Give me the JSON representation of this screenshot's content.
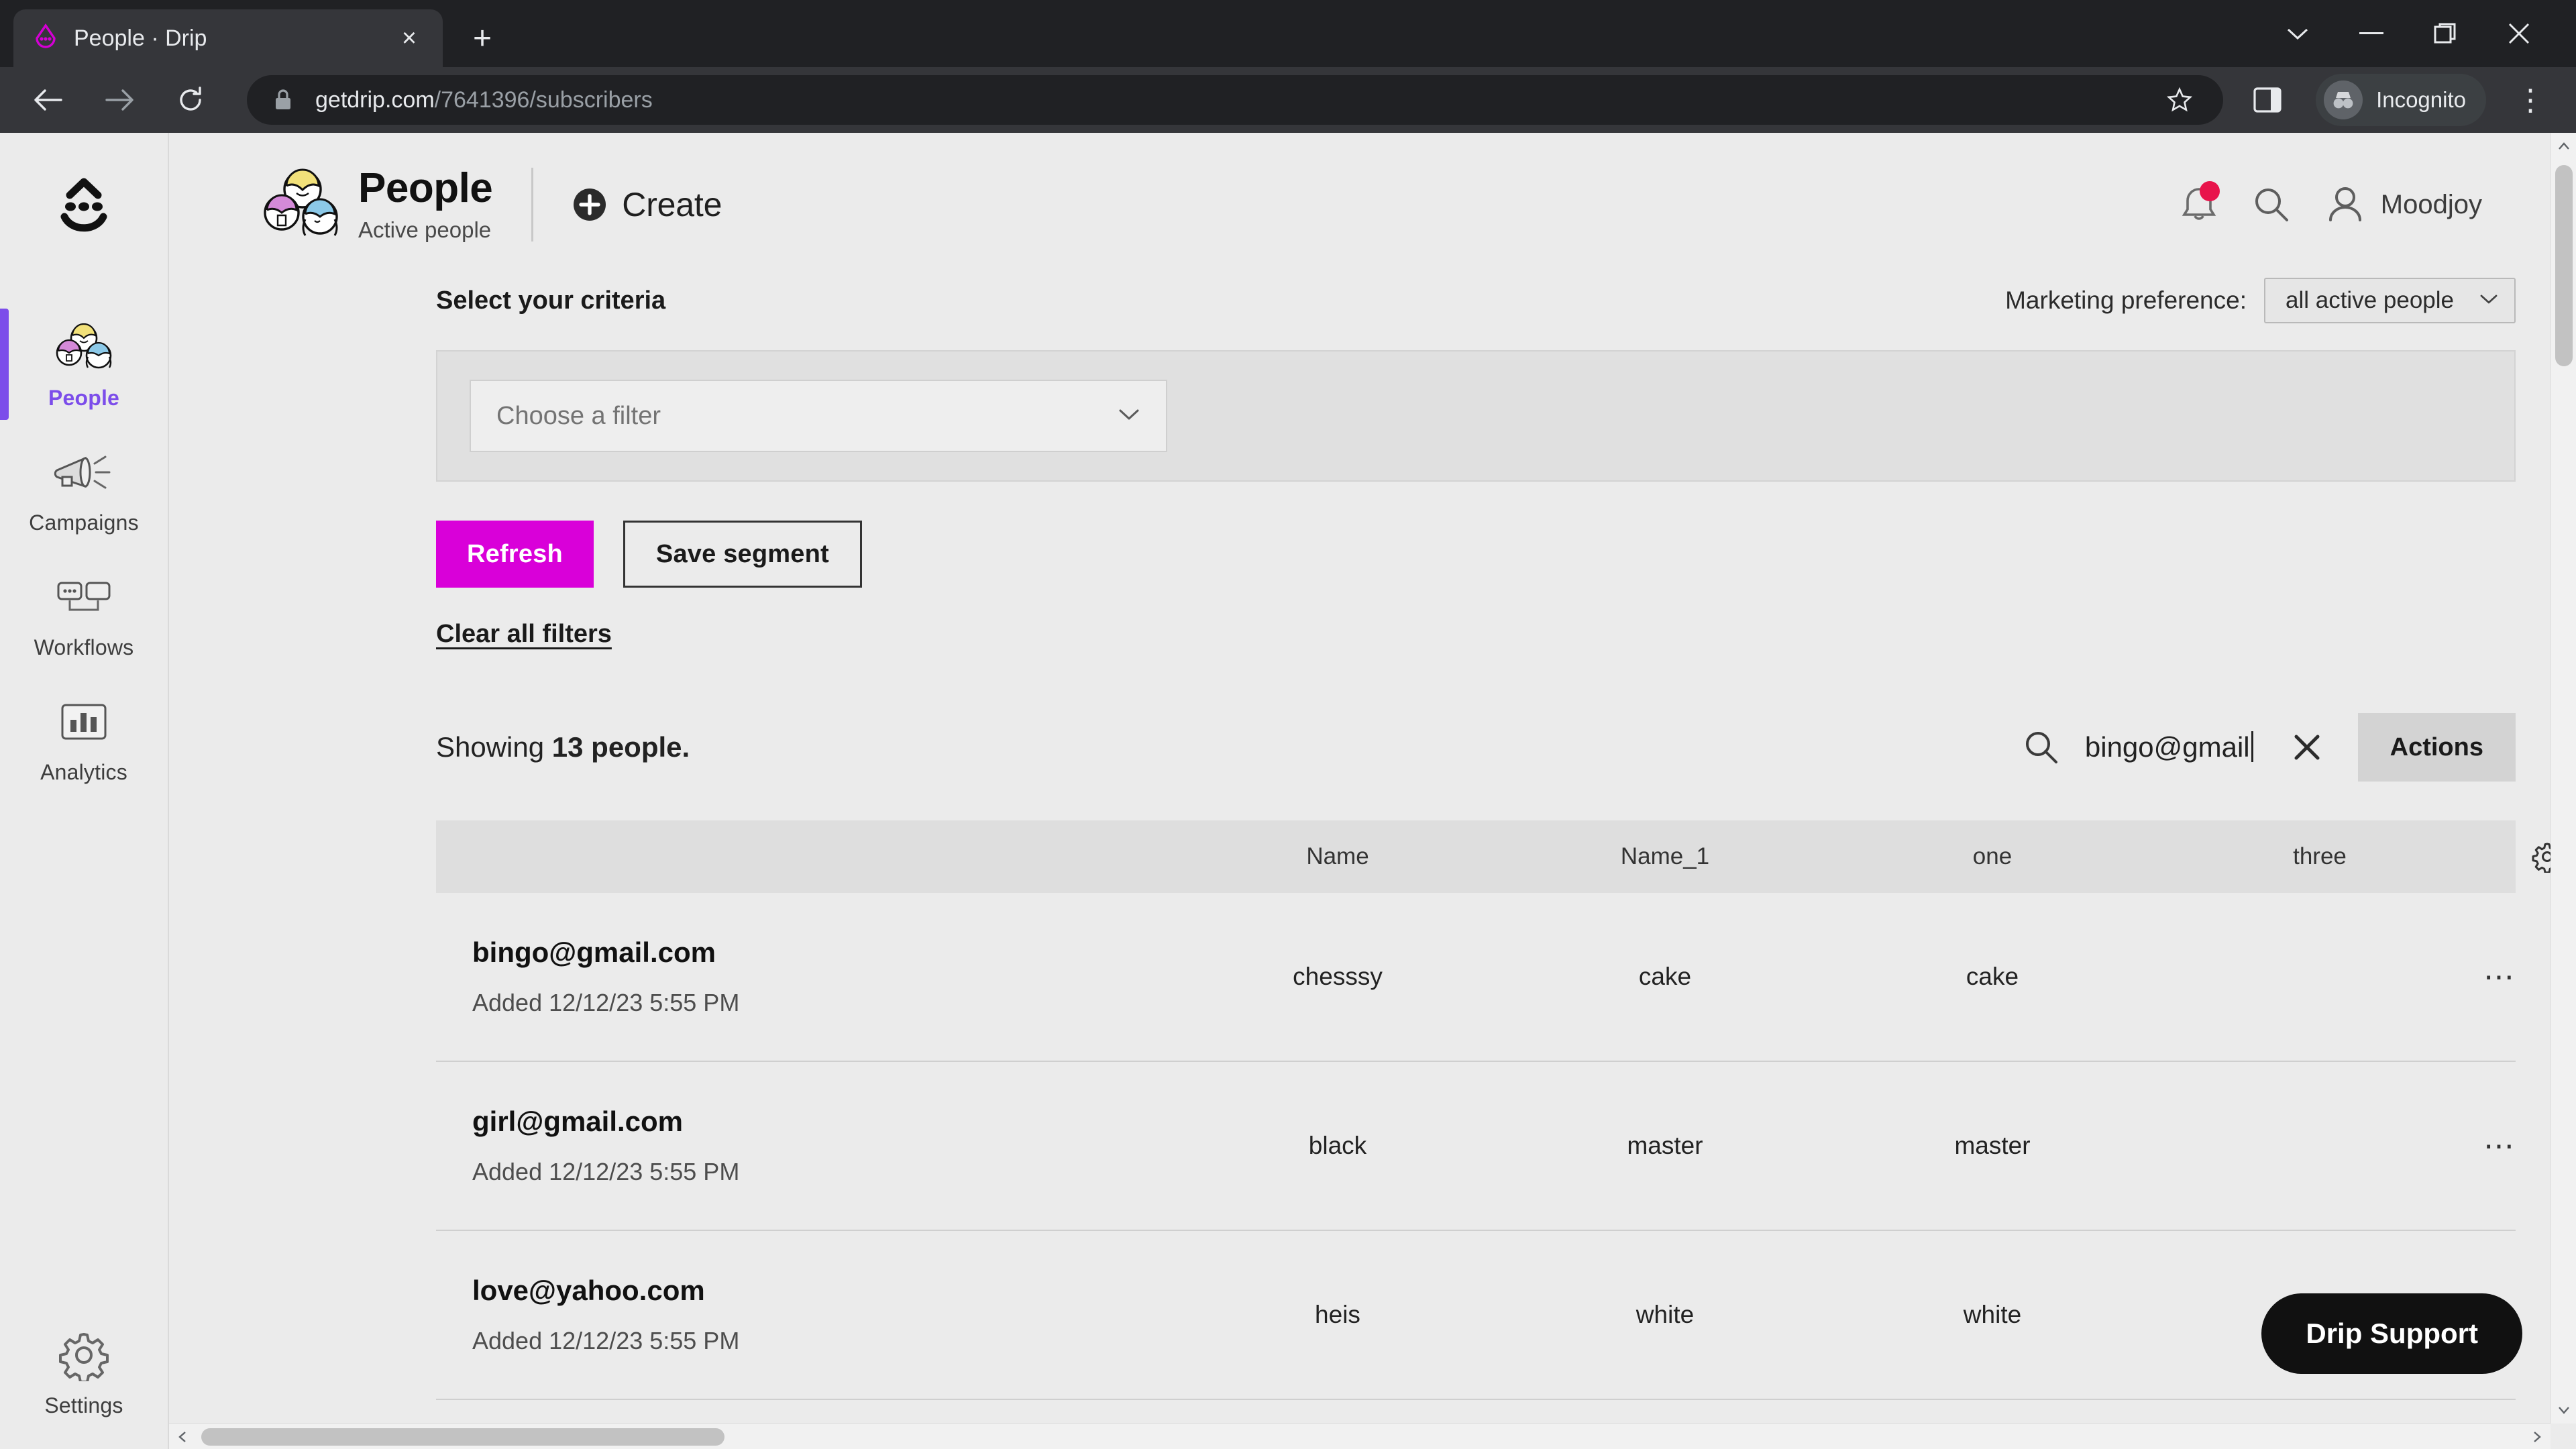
{
  "browser": {
    "tab": {
      "title": "People · Drip",
      "favicon": "drip-logo-icon",
      "close": "×"
    },
    "new_tab": "+",
    "window_controls": {
      "minimize": "–",
      "maximize": "❐",
      "close": "✕",
      "list": "⌄"
    },
    "nav": {
      "back": "←",
      "forward": "→",
      "reload": "⟳"
    },
    "url": {
      "domain": "getdrip.com",
      "path": "/7641396/subscribers",
      "lock": "lock-icon"
    },
    "star": "☆",
    "side_panel": "side-panel-icon",
    "incognito_label": "Incognito",
    "menu": "⋮"
  },
  "sidebar": {
    "logo": "drip-smiley-logo",
    "items": [
      {
        "label": "People",
        "icon": "people-icon",
        "active": true
      },
      {
        "label": "Campaigns",
        "icon": "megaphone-icon",
        "active": false
      },
      {
        "label": "Workflows",
        "icon": "workflow-icon",
        "active": false
      },
      {
        "label": "Analytics",
        "icon": "chart-bars-icon",
        "active": false
      }
    ],
    "bottom_item": {
      "label": "Settings",
      "icon": "gear-icon"
    },
    "active_color": "#7c4dea"
  },
  "header": {
    "icon": "people-group-icon",
    "title": "People",
    "subtitle": "Active people",
    "create_label": "Create",
    "create_icon": "plus-circle-icon",
    "notification_icon": "bell-icon",
    "notification_dot_color": "#e8144b",
    "search_icon": "search-icon",
    "user_icon": "person-icon",
    "user_name": "Moodjoy"
  },
  "criteria": {
    "title": "Select your criteria",
    "filter_placeholder": "Choose a filter",
    "filter_chevron": "chevron-down-icon",
    "marketing_pref_label": "Marketing preference:",
    "marketing_pref_value": "all active people"
  },
  "actions": {
    "refresh_label": "Refresh",
    "refresh_color": "#d900d9",
    "save_segment_label": "Save segment",
    "clear_filters_label": "Clear all filters"
  },
  "results": {
    "showing_prefix": "Showing ",
    "showing_count": "13 people.",
    "search_value": "bingo@gmail",
    "search_icon": "search-icon",
    "clear_icon": "close-icon",
    "actions_label": "Actions"
  },
  "table": {
    "columns": [
      "Name",
      "Name_1",
      "one",
      "three"
    ],
    "settings_icon": "gear-icon",
    "row_menu_icon": "ellipsis-icon",
    "row_edit_icon": "pencil-icon",
    "rows": [
      {
        "email": "bingo@gmail.com",
        "added": "Added 12/12/23 5:55 PM",
        "values": [
          "chesssy",
          "cake",
          "cake"
        ]
      },
      {
        "email": "girl@gmail.com",
        "added": "Added 12/12/23 5:55 PM",
        "values": [
          "black",
          "master",
          "master"
        ]
      },
      {
        "email": "love@yahoo.com",
        "added": "Added 12/12/23 5:55 PM",
        "values": [
          "heis",
          "white",
          "white"
        ]
      }
    ]
  },
  "support": {
    "label": "Drip Support"
  }
}
